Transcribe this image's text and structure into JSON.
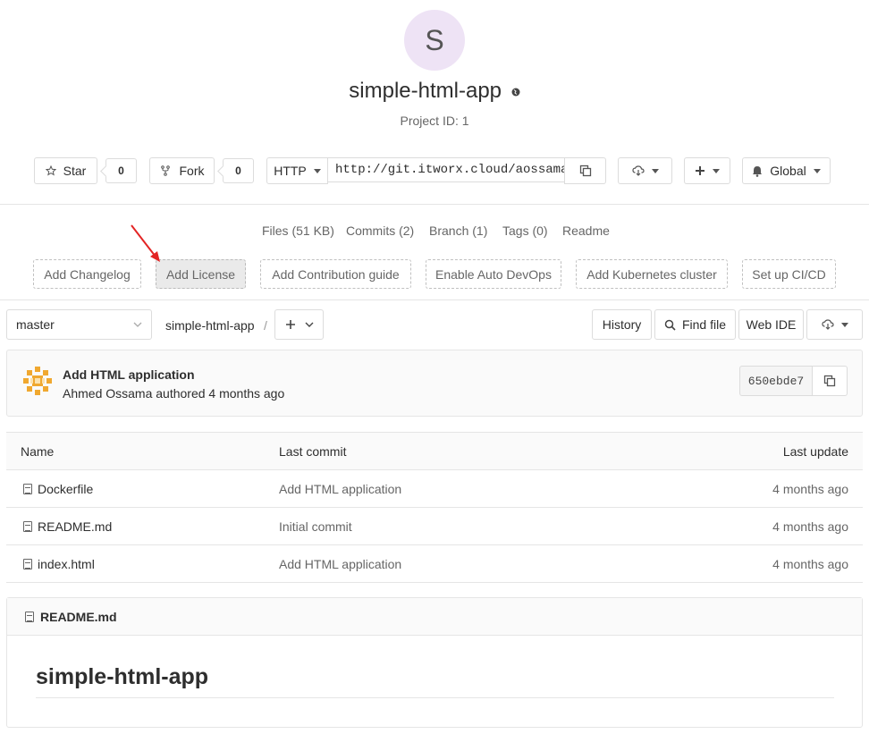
{
  "project": {
    "avatar_letter": "S",
    "name": "simple-html-app",
    "id_text": "Project ID: 1"
  },
  "actions": {
    "star_label": "Star",
    "star_count": "0",
    "fork_label": "Fork",
    "fork_count": "0",
    "protocol": "HTTP",
    "clone_url": "http://git.itworx.cloud/aossama/simple-html-app.git",
    "notification_label": "Global"
  },
  "stats": {
    "files": "Files (51 KB)",
    "commits": "Commits (2)",
    "branch": "Branch (1)",
    "tags": "Tags (0)",
    "readme": "Readme"
  },
  "quick_actions": [
    {
      "label": "Add Changelog"
    },
    {
      "label": "Add License"
    },
    {
      "label": "Add Contribution guide"
    },
    {
      "label": "Enable Auto DevOps"
    },
    {
      "label": "Add Kubernetes cluster"
    },
    {
      "label": "Set up CI/CD"
    }
  ],
  "tree_nav": {
    "branch": "master",
    "path": "simple-html-app",
    "separator": "/",
    "history_label": "History",
    "find_file_label": "Find file",
    "web_ide_label": "Web IDE"
  },
  "last_commit": {
    "title": "Add HTML application",
    "author_line": "Ahmed Ossama authored 4 months ago",
    "sha": "650ebde7"
  },
  "files_table": {
    "headers": {
      "name": "Name",
      "last_commit": "Last commit",
      "last_update": "Last update"
    },
    "rows": [
      {
        "name": "Dockerfile",
        "commit": "Add HTML application",
        "updated": "4 months ago"
      },
      {
        "name": "README.md",
        "commit": "Initial commit",
        "updated": "4 months ago"
      },
      {
        "name": "index.html",
        "commit": "Add HTML application",
        "updated": "4 months ago"
      }
    ]
  },
  "readme": {
    "filename": "README.md",
    "heading": "simple-html-app"
  },
  "colors": {
    "annotation_arrow": "#e32424",
    "avatar_bg": "#eee3f5"
  }
}
